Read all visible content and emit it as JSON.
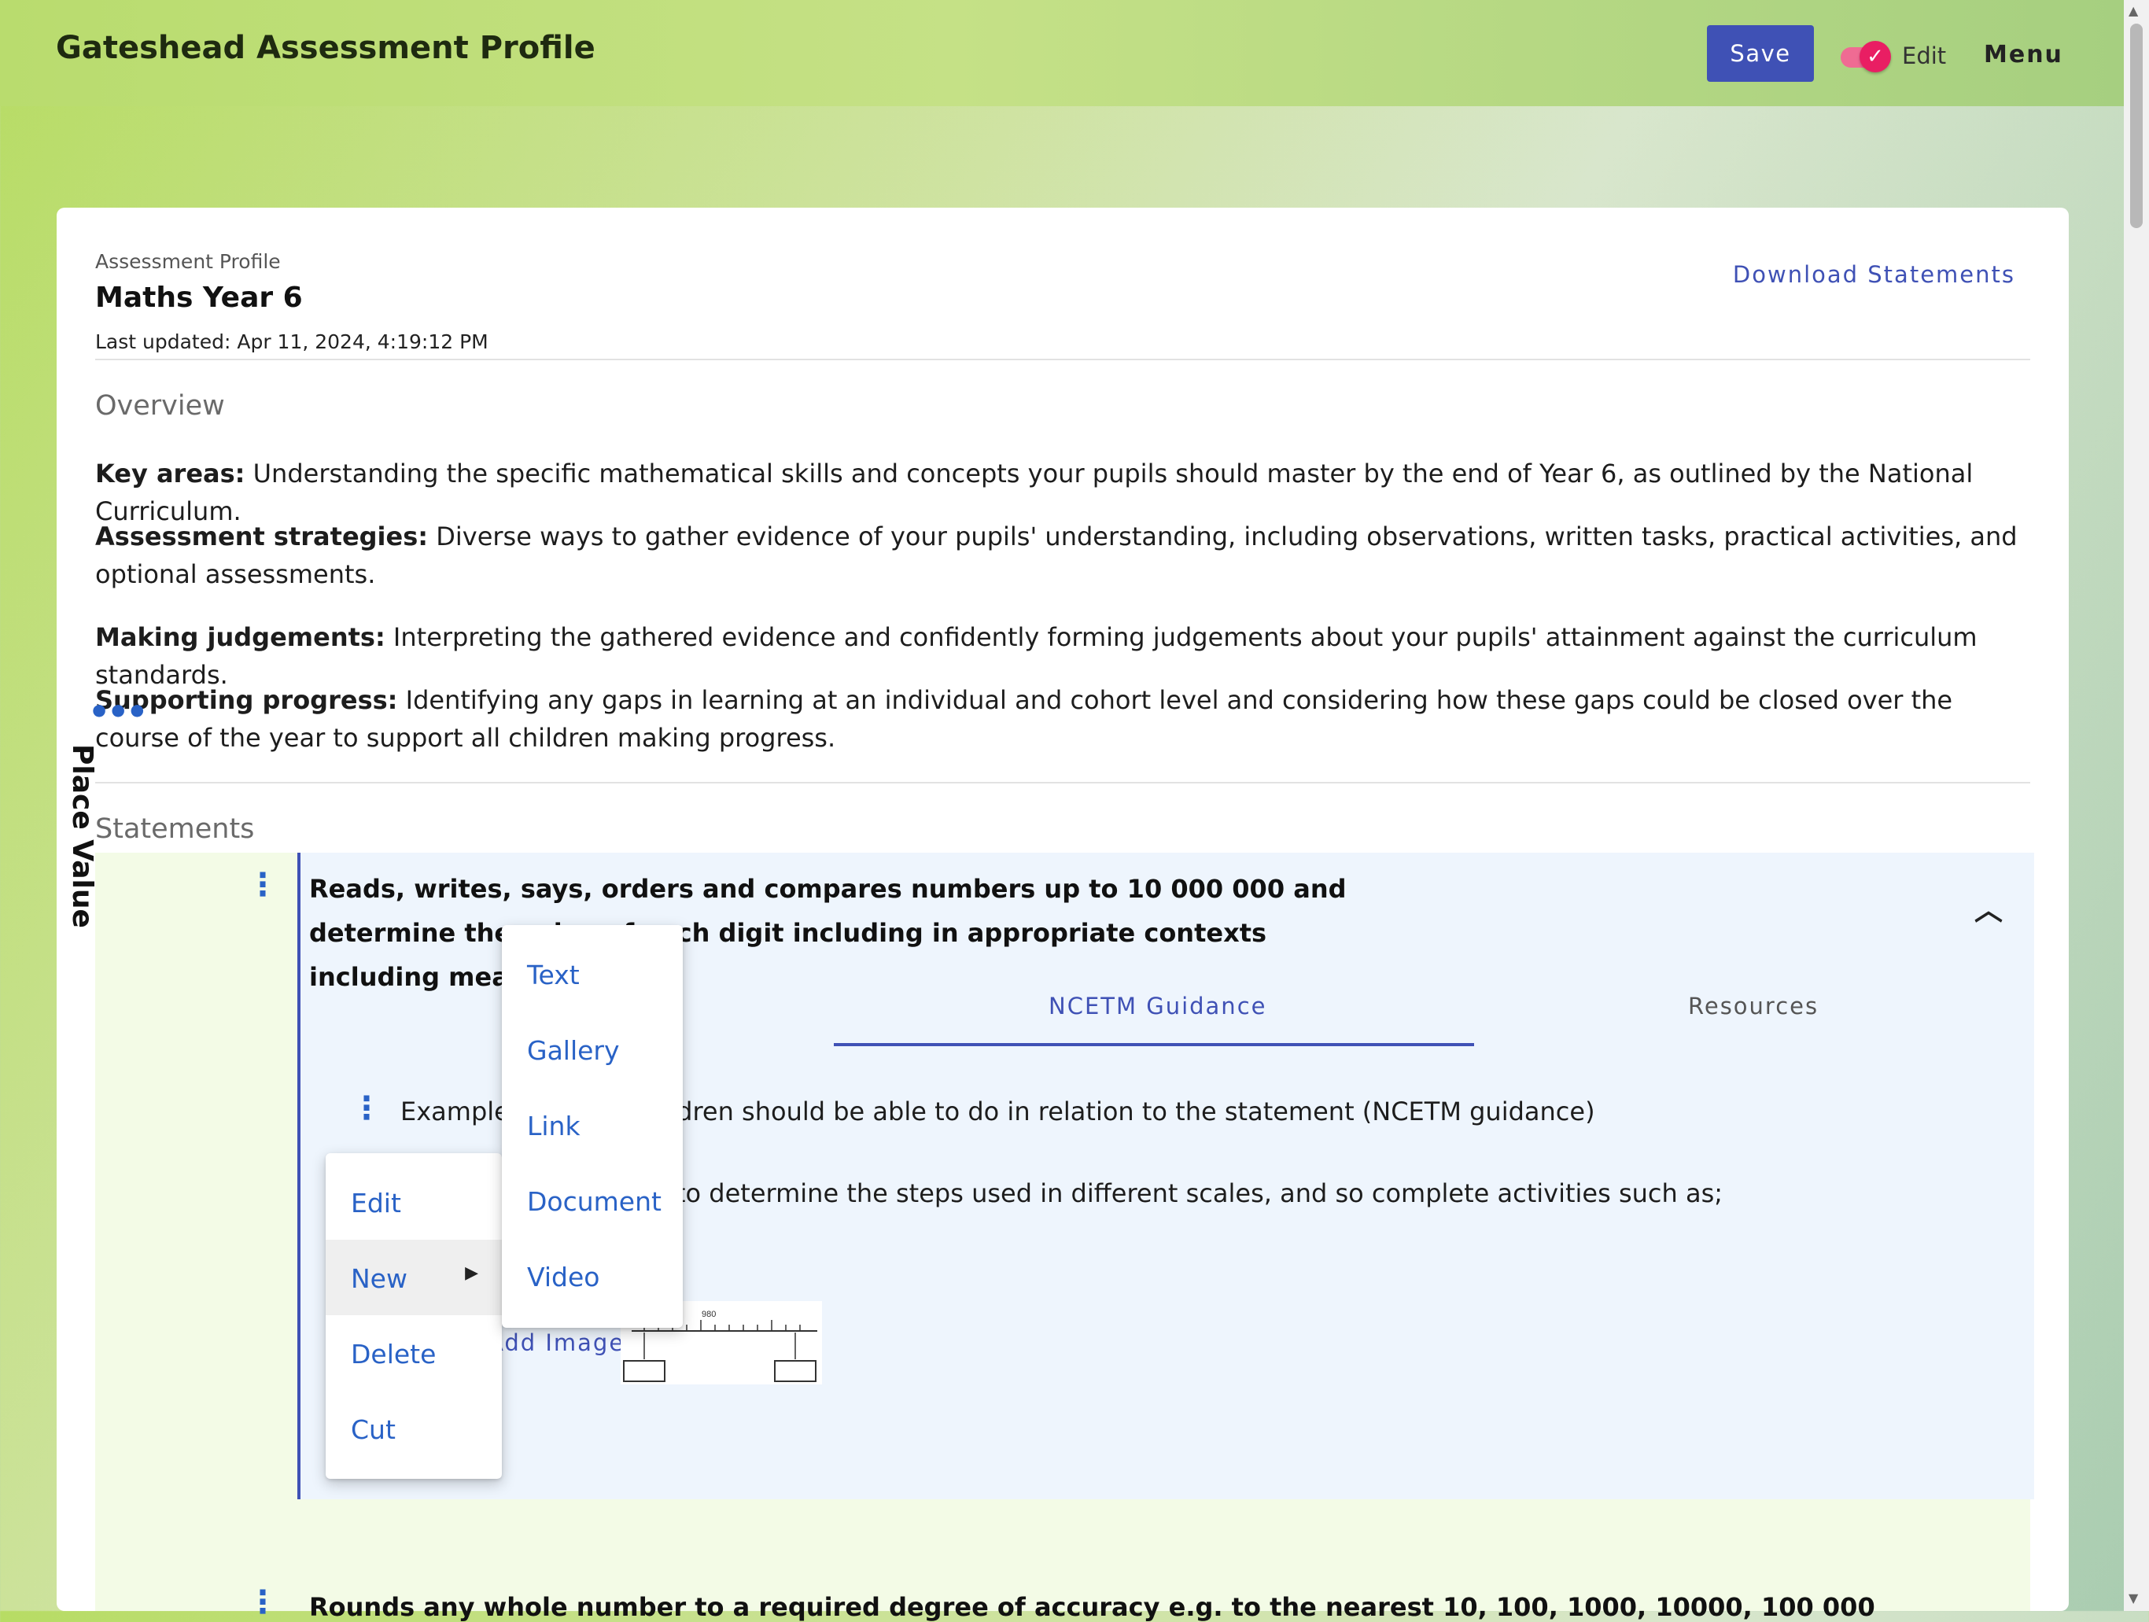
{
  "header": {
    "title": "Gateshead Assessment Profile",
    "save_label": "Save",
    "edit_toggle_label": "Edit",
    "edit_toggle_on": true,
    "menu_label": "Menu"
  },
  "profile": {
    "eyebrow": "Assessment Profile",
    "title": "Maths Year 6",
    "last_updated": "Last updated: Apr 11, 2024, 4:19:12 PM",
    "download_label": "Download Statements"
  },
  "overview": {
    "title": "Overview",
    "items": [
      {
        "label": "Key areas:",
        "text": " Understanding the specific mathematical skills and concepts your pupils should master by the end of Year 6, as outlined by the National Curriculum."
      },
      {
        "label": "Assessment strategies:",
        "text": " Diverse ways to gather evidence of your pupils' understanding, including observations, written tasks, practical activities, and optional assessments."
      },
      {
        "label": "Making judgements:",
        "text": " Interpreting the gathered evidence and confidently forming judgements about your pupils' attainment against the curriculum standards."
      },
      {
        "label": "Supporting progress:",
        "text": " Identifying any gaps in learning at an individual and cohort level and considering how these gaps could be closed over the course of the year to support all children making progress."
      }
    ]
  },
  "statements": {
    "title": "Statements",
    "category_label": "Place Value",
    "current": {
      "text": "Reads, writes, says, orders and compares numbers up to 10 000 000 and determine the value of each digit including in appropriate contexts including measurement.",
      "tabs": [
        "NCETM Guidance",
        "Resources"
      ],
      "active_tab": "NCETM Guidance",
      "example_text": "Examples of what children should be able to do in relation to the statement (NCETM guidance)",
      "steps_text": "Pupils should be able to determine the steps used in different scales, and so complete activities such as;",
      "add_image_label": "Add Image",
      "scale_tick_label": "980"
    },
    "next_text": "Rounds any whole number to a required degree of accuracy e.g. to the nearest 10, 100, 1000, 10000, 100 000"
  },
  "context_menu": {
    "items": [
      "Edit",
      "New",
      "Delete",
      "Cut"
    ],
    "active_item": "New"
  },
  "new_submenu": {
    "items": [
      "Text",
      "Gallery",
      "Link",
      "Document",
      "Video"
    ]
  },
  "colors": {
    "primary": "#3f51b5",
    "toggle": "#e91e63",
    "link": "#2962c6"
  }
}
